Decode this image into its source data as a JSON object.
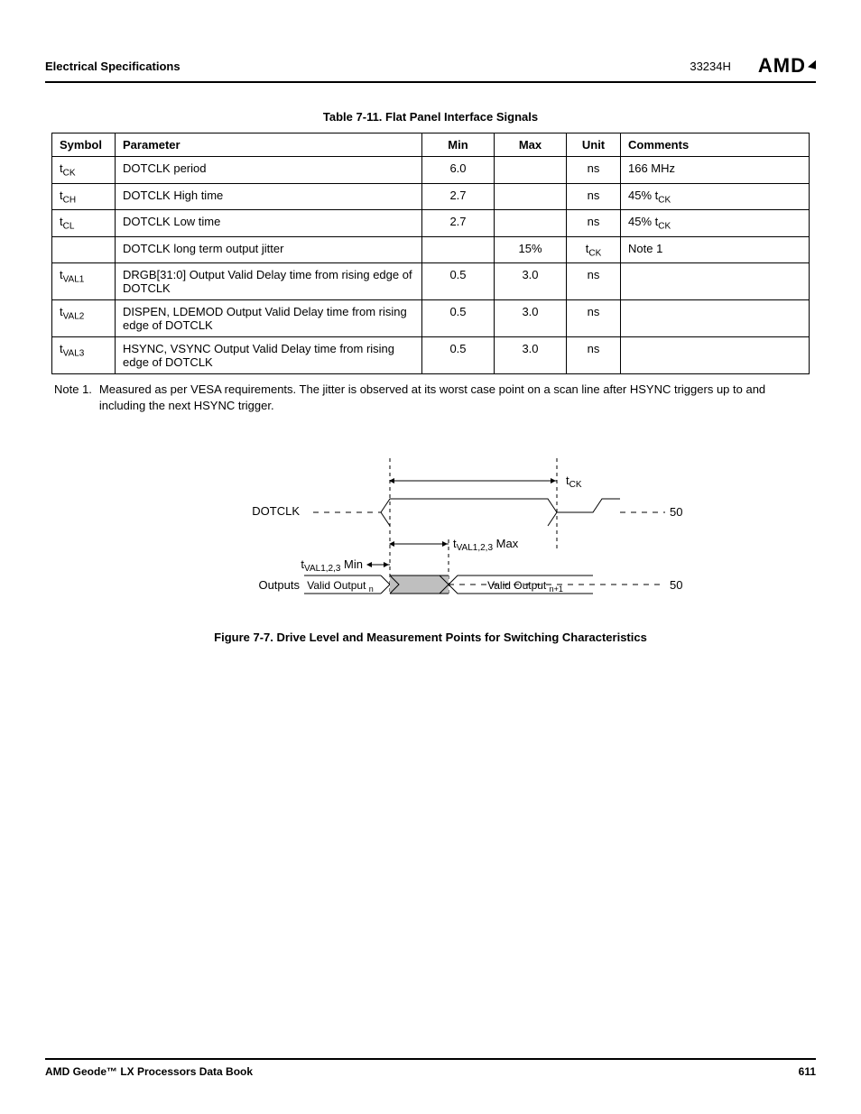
{
  "header": {
    "section": "Electrical Specifications",
    "docnum": "33234H",
    "logo": "AMD"
  },
  "table": {
    "title": "Table 7-11.  Flat Panel Interface Signals",
    "columns": {
      "symbol": "Symbol",
      "parameter": "Parameter",
      "min": "Min",
      "max": "Max",
      "unit": "Unit",
      "comments": "Comments"
    },
    "rows": [
      {
        "sym_base": "t",
        "sym_sub": "CK",
        "param": "DOTCLK period",
        "min": "6.0",
        "max": "",
        "unit": "ns",
        "comments": "166 MHz"
      },
      {
        "sym_base": "t",
        "sym_sub": "CH",
        "param": "DOTCLK High time",
        "min": "2.7",
        "max": "",
        "unit": "ns",
        "comments_pre": "45% t",
        "comments_sub": "CK"
      },
      {
        "sym_base": "t",
        "sym_sub": "CL",
        "param": "DOTCLK Low time",
        "min": "2.7",
        "max": "",
        "unit": "ns",
        "comments_pre": "45% t",
        "comments_sub": "CK"
      },
      {
        "sym_base": "",
        "sym_sub": "",
        "param": "DOTCLK long term output jitter",
        "min": "",
        "max": "15%",
        "unit_pre": "t",
        "unit_sub": "CK",
        "comments": "Note 1"
      },
      {
        "sym_base": "t",
        "sym_sub": "VAL1",
        "param": "DRGB[31:0] Output Valid Delay time from rising edge of DOTCLK",
        "min": "0.5",
        "max": "3.0",
        "unit": "ns",
        "comments": ""
      },
      {
        "sym_base": "t",
        "sym_sub": "VAL2",
        "param": "DISPEN, LDEMOD Output Valid Delay time from rising edge of DOTCLK",
        "min": "0.5",
        "max": "3.0",
        "unit": "ns",
        "comments": ""
      },
      {
        "sym_base": "t",
        "sym_sub": "VAL3",
        "param": "HSYNC, VSYNC Output Valid Delay time from rising edge of DOTCLK",
        "min": "0.5",
        "max": "3.0",
        "unit": "ns",
        "comments": ""
      }
    ]
  },
  "note": {
    "label": "Note 1.",
    "text": "Measured as per VESA requirements. The jitter is observed at its worst case point on a scan line after HSYNC triggers up to and including the next HSYNC trigger."
  },
  "figure": {
    "dotclk_label": "DOTCLK",
    "outputs_label": "Outputs",
    "tck_label": "t",
    "tck_sub": "CK",
    "tval_max_pre": "t",
    "tval_max_sub": "VAL1,2,3",
    "tval_max_post": " Max",
    "tval_min_pre": "t",
    "tval_min_sub": "VAL1,2,3",
    "tval_min_post": " Min",
    "valid_n_pre": "Valid Output ",
    "valid_n_sub": "n",
    "valid_n1_pre": "Valid Output ",
    "valid_n1_sub": "n+1",
    "fifty": "50%",
    "title": "Figure 7-7.  Drive Level and Measurement Points for Switching Characteristics"
  },
  "footer": {
    "left": "AMD Geode™ LX Processors Data Book",
    "right": "611"
  }
}
